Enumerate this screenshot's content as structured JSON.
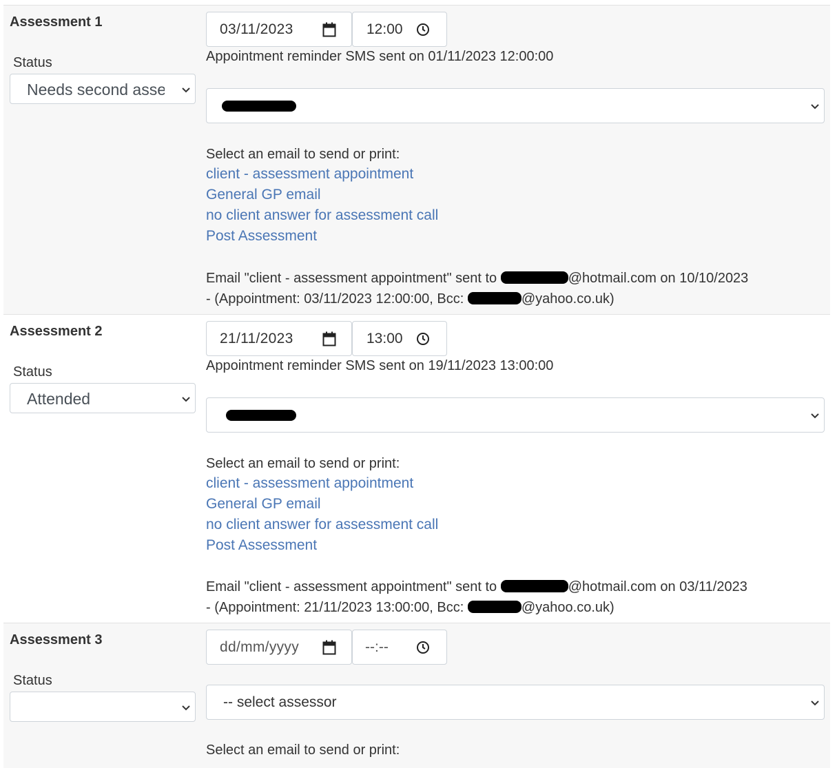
{
  "assessments": [
    {
      "title": "Assessment 1",
      "status_label": "Status",
      "status_value": "Needs second assessment",
      "date": "03/11/2023",
      "time": "12:00",
      "sms_note": "Appointment reminder SMS sent on 01/11/2023 12:00:00",
      "assessor": "",
      "email_prompt": "Select an email to send or print:",
      "email_links": [
        "client - assessment appointment",
        "General GP email",
        "no client answer for assessment call",
        "Post Assessment"
      ],
      "sent_prefix": "Email \"client - assessment appointment\" sent to ",
      "sent_suffix": "@hotmail.com on 10/10/2023",
      "sent_detail_prefix": " - (Appointment: 03/11/2023 12:00:00, Bcc: ",
      "sent_detail_suffix": "@yahoo.co.uk)"
    },
    {
      "title": "Assessment 2",
      "status_label": "Status",
      "status_value": "Attended",
      "date": "21/11/2023",
      "time": "13:00",
      "sms_note": "Appointment reminder SMS sent on 19/11/2023 13:00:00",
      "assessor": "",
      "email_prompt": "Select an email to send or print:",
      "email_links": [
        "client - assessment appointment",
        "General GP email",
        "no client answer for assessment call",
        "Post Assessment"
      ],
      "sent_prefix": "Email \"client - assessment appointment\" sent to ",
      "sent_suffix": "@hotmail.com on 03/11/2023",
      "sent_detail_prefix": " - (Appointment: 21/11/2023 13:00:00, Bcc: ",
      "sent_detail_suffix": "@yahoo.co.uk)"
    },
    {
      "title": "Assessment 3",
      "status_label": "Status",
      "status_value": "",
      "date_placeholder": "dd/mm/yyyy",
      "time_placeholder": "--:--",
      "assessor_placeholder": "-- select assessor",
      "email_prompt": "Select an email to send or print:"
    }
  ],
  "colors": {
    "link": "#4a76b5",
    "row_shaded": "#f7f7f7",
    "border": "#ced4da"
  },
  "icons": {
    "date": "calendar-icon",
    "time": "clock-icon",
    "select": "chevron-down-icon"
  }
}
